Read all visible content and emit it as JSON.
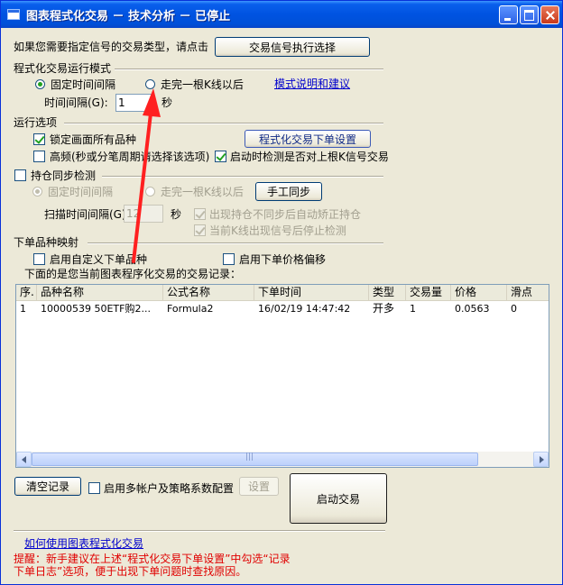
{
  "window": {
    "title": "图表程式化交易 － 技术分析 － 已停止"
  },
  "signal_type": {
    "prompt": "如果您需要指定信号的交易类型，请点击",
    "button": "交易信号执行选择"
  },
  "run_mode": {
    "heading": "程式化交易运行模式",
    "fixed_interval": "固定时间间隔",
    "after_kline": "走完一根K线以后",
    "mode_help_link": "模式说明和建议",
    "interval_label": "时间间隔(G):",
    "interval_value": "1",
    "interval_unit": "秒",
    "selected": "fixed_interval"
  },
  "run_options": {
    "heading": "运行选项",
    "lock_all": "锁定画面所有品种",
    "lock_all_checked": true,
    "order_settings_button": "程式化交易下单设置",
    "high_freq": "高频(秒或分笔周期请选择该选项)",
    "high_freq_checked": false,
    "check_last_signal": "启动时检测是否对上根K信号交易",
    "check_last_signal_checked": true
  },
  "position_sync": {
    "heading": "持仓同步检测",
    "checked": false,
    "fixed_interval": "固定时间间隔",
    "after_kline": "走完一根K线以后",
    "manual_sync_button": "手工同步",
    "scan_interval_label": "扫描时间间隔(G):",
    "scan_interval_value": "12",
    "scan_interval_unit": "秒",
    "auto_correct": "出现持仓不同步后自动矫正持仓",
    "auto_correct_checked": true,
    "stop_on_signal": "当前K线出现信号后停止检测",
    "stop_on_signal_checked": true
  },
  "order_mapping": {
    "heading": "下单品种映射",
    "custom_symbol": "启用自定义下单品种",
    "custom_symbol_checked": false,
    "price_offset": "启用下单价格偏移",
    "price_offset_checked": false,
    "records_caption": "下面的是您当前图表程序化交易的交易记录："
  },
  "table": {
    "columns": [
      "序.",
      "品种名称",
      "公式名称",
      "下单时间",
      "类型",
      "交易量",
      "价格",
      "滑点"
    ],
    "rows": [
      [
        "1",
        "10000539 50ETF购2...",
        "Formula2",
        "16/02/19 14:47:42",
        "开多",
        "1",
        "0.0563",
        "0"
      ]
    ],
    "scroll_grip": "|||"
  },
  "bottom": {
    "clear_button": "清空记录",
    "multi_account": "启用多帐户及策略系数配置",
    "multi_account_checked": false,
    "settings_button": "设置",
    "start_button": "启动交易",
    "howto_link": "如何使用图表程式化交易",
    "reminder_line1": "提醒：新手建议在上述“程式化交易下单设置”中勾选“记录",
    "reminder_line2": "下单日志”选项，便于出现下单问题时查找原因。"
  },
  "colors": {
    "title_bar": "#0053E1",
    "dialog_bg": "#ECE9D8",
    "link": "#0000CC",
    "reminder": "#E00000",
    "annotation_arrow": "#FF2020"
  }
}
